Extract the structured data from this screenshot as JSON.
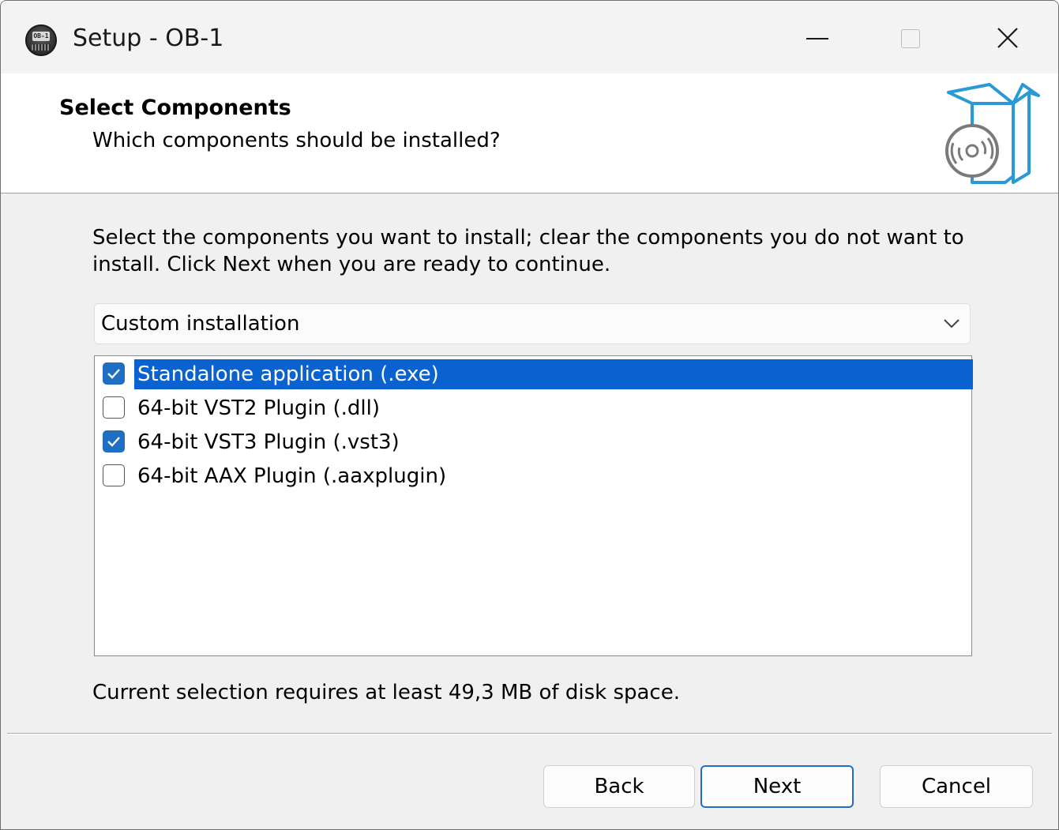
{
  "window": {
    "title": "Setup - OB-1",
    "icon_badge": "OB-1"
  },
  "header": {
    "title": "Select Components",
    "subtitle": "Which components should be installed?"
  },
  "instructions": "Select the components you want to install; clear the components you do not want to install. Click Next when you are ready to continue.",
  "installation_type": {
    "selected": "Custom installation"
  },
  "components": [
    {
      "label": "Standalone application (.exe)",
      "checked": true,
      "selected": true
    },
    {
      "label": "64-bit VST2 Plugin (.dll)",
      "checked": false,
      "selected": false
    },
    {
      "label": "64-bit VST3 Plugin (.vst3)",
      "checked": true,
      "selected": false
    },
    {
      "label": "64-bit AAX Plugin (.aaxplugin)",
      "checked": false,
      "selected": false
    }
  ],
  "disk_space": "Current selection requires at least 49,3 MB of disk space.",
  "buttons": {
    "back": "Back",
    "next": "Next",
    "cancel": "Cancel"
  },
  "colors": {
    "accent": "#1e6fc4",
    "selection": "#0a62d0",
    "header_graphic": "#2a9ad6"
  },
  "icons": {
    "app": "ob1-synth-icon",
    "header": "box-with-disc-icon",
    "minimize": "minimize-icon",
    "maximize": "maximize-icon",
    "close": "close-icon",
    "dropdown": "chevron-down-icon",
    "check": "checkmark-icon"
  }
}
